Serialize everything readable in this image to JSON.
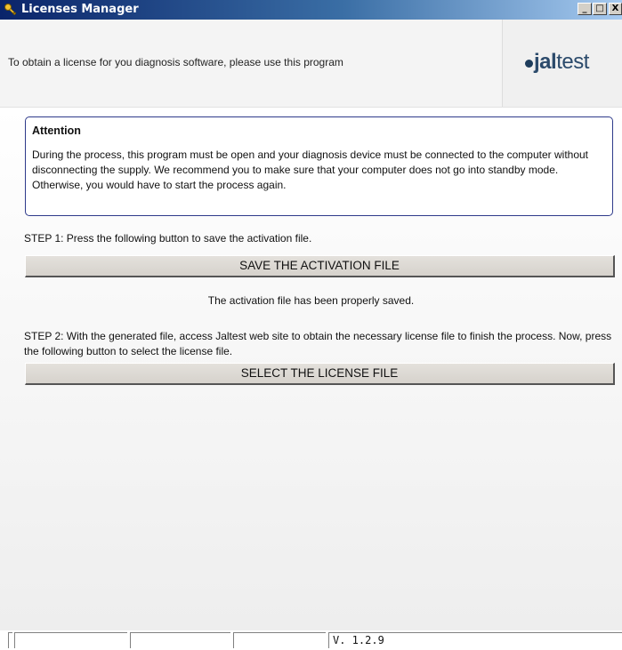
{
  "window": {
    "title": "Licenses Manager",
    "buttons": {
      "minimize": "_",
      "maximize": "□",
      "close": "X"
    }
  },
  "header": {
    "text": "To obtain a license for you diagnosis software, please use this program",
    "logo_bold": "jal",
    "logo_light": "test"
  },
  "attention": {
    "title": "Attention",
    "text": "During the process, this program must be open and your diagnosis device must be connected to the computer without disconnecting the supply. We recommend you to make sure that your computer does not go into standby mode. Otherwise, you would have to start the process again."
  },
  "step1": {
    "text": "STEP 1: Press the following button to save the activation file.",
    "button": "SAVE THE ACTIVATION FILE",
    "status": "The activation file has been properly saved."
  },
  "step2": {
    "text": "STEP 2: With the generated file, access Jaltest web site to obtain the necessary license file to finish the process. Now, press the following button to select the license file.",
    "button": "SELECT THE LICENSE FILE"
  },
  "statusbar": {
    "version": "V. 1.2.9"
  },
  "colors": {
    "title_bar": "#0a246a",
    "attention_border": "#2e3a8a",
    "logo": "#2b4a6b"
  }
}
